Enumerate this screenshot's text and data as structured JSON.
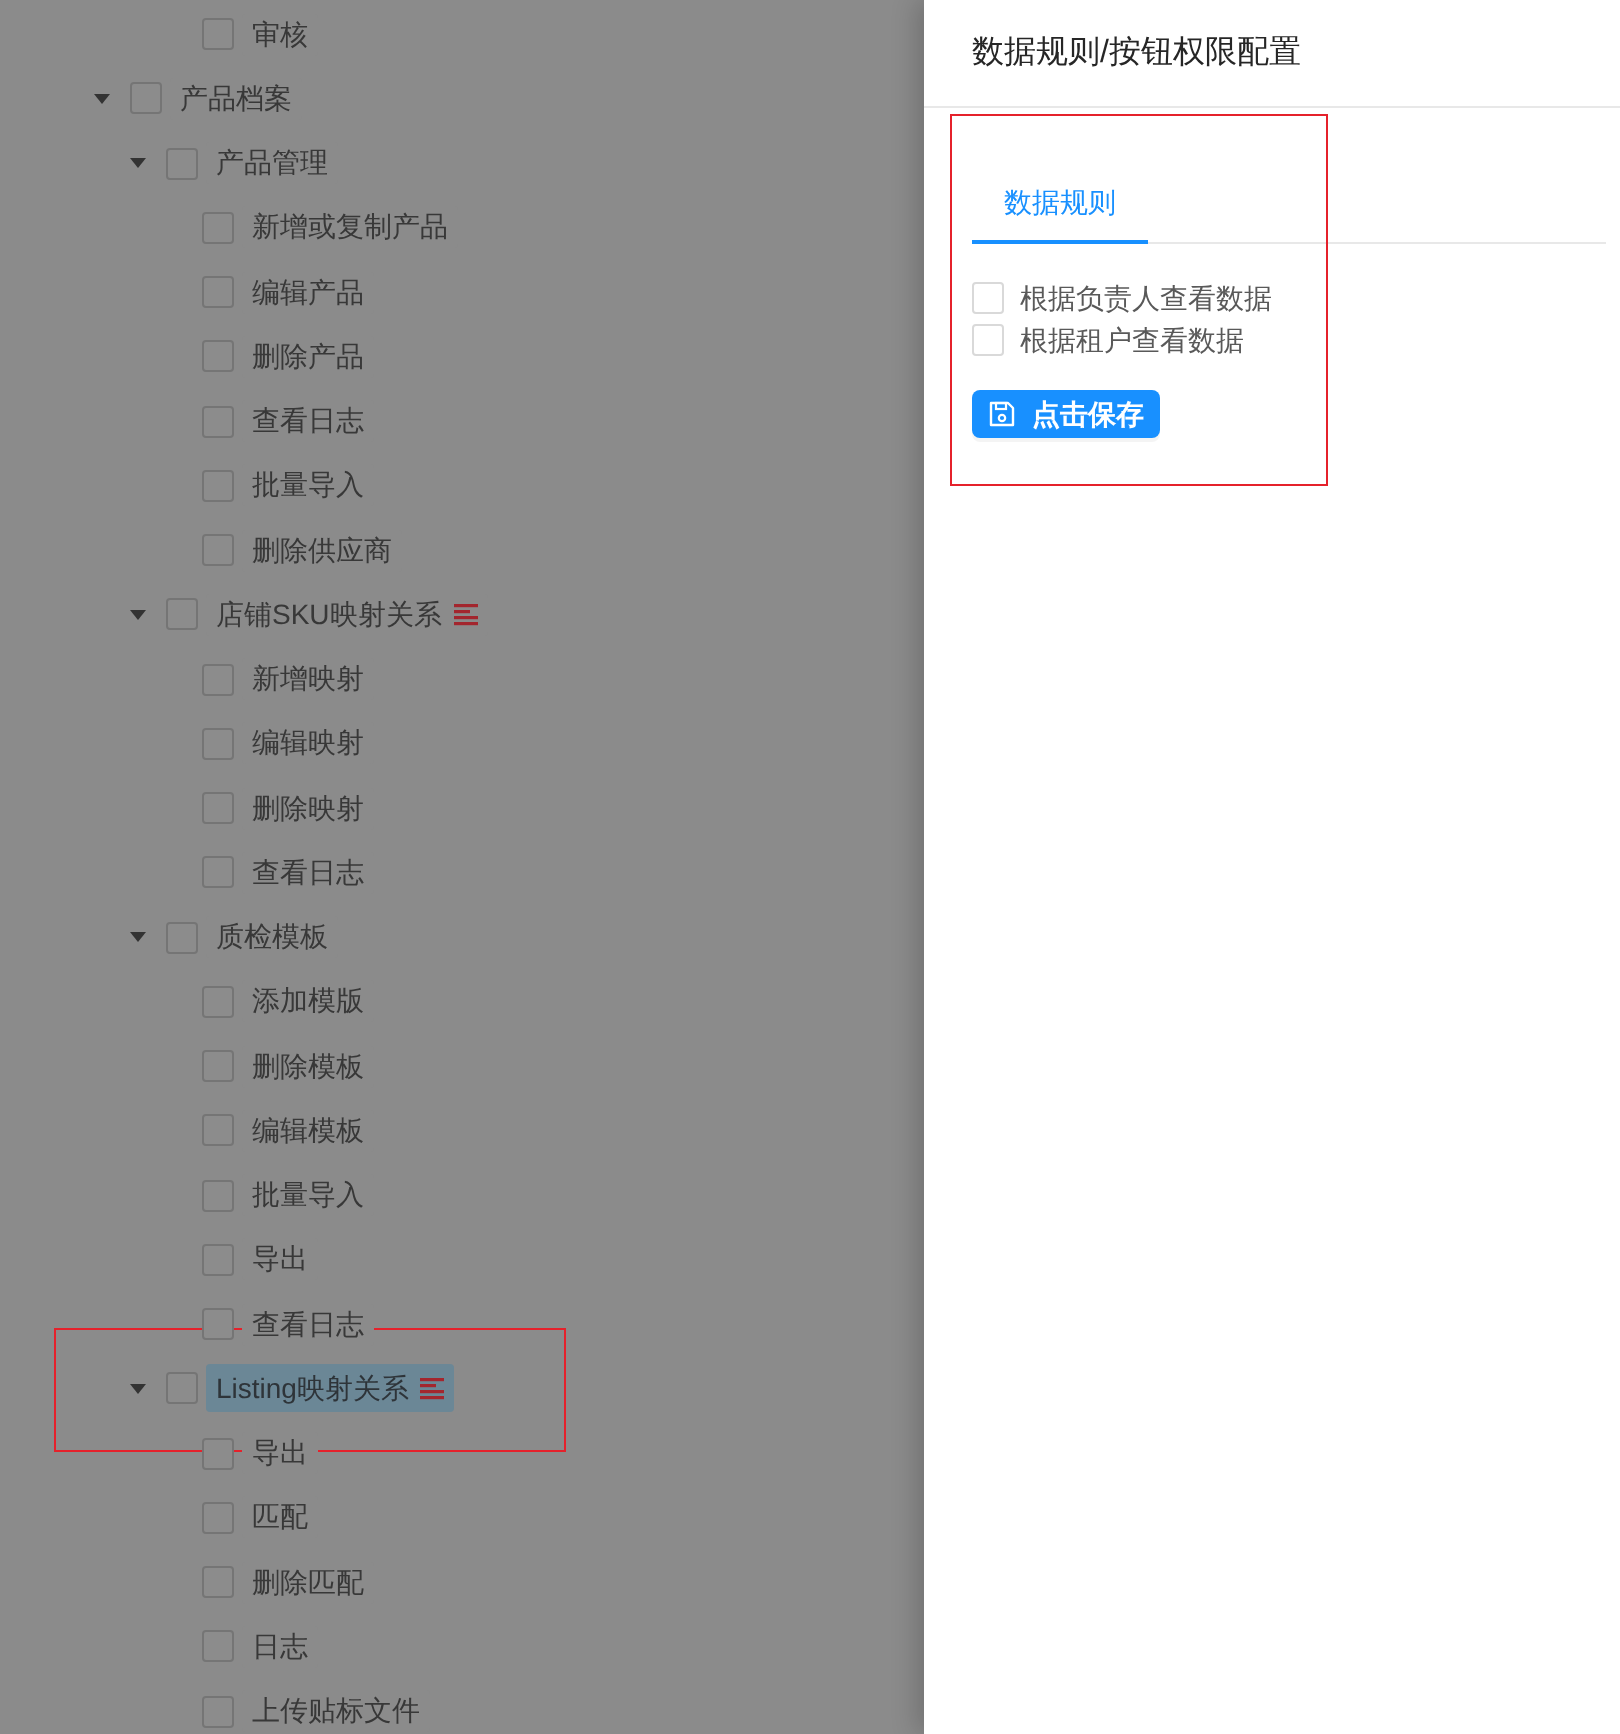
{
  "tree": [
    {
      "children": [
        {
          "children": [
            {
              "label": "审核",
              "checked": false,
              "selected": false
            }
          ]
        }
      ]
    },
    {
      "label": "产品档案",
      "checked": false,
      "selected": false,
      "expanded": true,
      "children": [
        {
          "label": "产品管理",
          "checked": false,
          "selected": false,
          "expanded": true,
          "children": [
            {
              "label": "新增或复制产品",
              "checked": false,
              "selected": false
            },
            {
              "label": "编辑产品",
              "checked": false,
              "selected": false
            },
            {
              "label": "删除产品",
              "checked": false,
              "selected": false
            },
            {
              "label": "查看日志",
              "checked": false,
              "selected": false
            },
            {
              "label": "批量导入",
              "checked": false,
              "selected": false
            },
            {
              "label": "删除供应商",
              "checked": false,
              "selected": false
            }
          ]
        },
        {
          "label": "店铺SKU映射关系",
          "checked": false,
          "selected": false,
          "menu_icon": true,
          "expanded": true,
          "children": [
            {
              "label": "新增映射",
              "checked": false,
              "selected": false
            },
            {
              "label": "编辑映射",
              "checked": false,
              "selected": false
            },
            {
              "label": "删除映射",
              "checked": false,
              "selected": false
            },
            {
              "label": "查看日志",
              "checked": false,
              "selected": false
            }
          ]
        },
        {
          "label": "质检模板",
          "checked": false,
          "selected": false,
          "expanded": true,
          "children": [
            {
              "label": "添加模版",
              "checked": false,
              "selected": false
            },
            {
              "label": "删除模板",
              "checked": false,
              "selected": false
            },
            {
              "label": "编辑模板",
              "checked": false,
              "selected": false
            },
            {
              "label": "批量导入",
              "checked": false,
              "selected": false
            },
            {
              "label": "导出",
              "checked": false,
              "selected": false
            },
            {
              "label": "查看日志",
              "checked": false,
              "selected": false
            }
          ]
        },
        {
          "label": "Listing映射关系",
          "checked": false,
          "selected": true,
          "menu_icon": true,
          "expanded": true,
          "children": [
            {
              "label": "导出",
              "checked": false,
              "selected": false
            },
            {
              "label": "匹配",
              "checked": false,
              "selected": false
            },
            {
              "label": "删除匹配",
              "checked": false,
              "selected": false
            },
            {
              "label": "日志",
              "checked": false,
              "selected": false
            },
            {
              "label": "上传贴标文件",
              "checked": false,
              "selected": false
            }
          ]
        }
      ]
    }
  ],
  "drawer": {
    "title": "数据规则/按钮权限配置",
    "tabs": [
      {
        "label": "数据规则",
        "selected": true
      }
    ],
    "options": [
      {
        "label": "根据负责人查看数据",
        "checked": false
      },
      {
        "label": "根据租户查看数据",
        "checked": false
      }
    ],
    "save_button": {
      "label": "点击保存"
    }
  }
}
